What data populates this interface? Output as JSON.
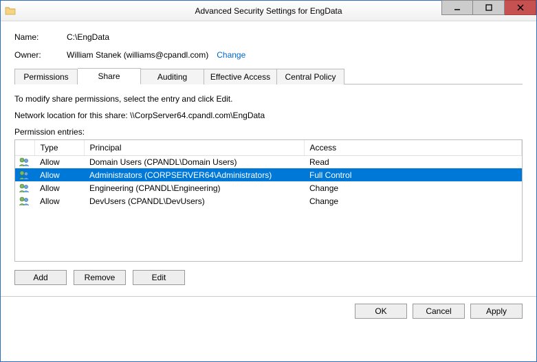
{
  "window": {
    "title": "Advanced Security Settings for EngData"
  },
  "fields": {
    "name_label": "Name:",
    "name_value": "C:\\EngData",
    "owner_label": "Owner:",
    "owner_value": "William Stanek (williams@cpandl.com)",
    "change_link": "Change"
  },
  "tabs": [
    {
      "label": "Permissions",
      "active": false
    },
    {
      "label": "Share",
      "active": true
    },
    {
      "label": "Auditing",
      "active": false
    },
    {
      "label": "Effective Access",
      "active": false
    },
    {
      "label": "Central Policy",
      "active": false
    }
  ],
  "panel": {
    "instruction": "To modify share permissions, select the entry and click Edit.",
    "location_label": "Network location for this share:  \\\\CorpServer64.cpandl.com\\EngData",
    "entries_label": "Permission entries:"
  },
  "columns": {
    "type": "Type",
    "principal": "Principal",
    "access": "Access"
  },
  "entries": [
    {
      "type": "Allow",
      "principal": "Domain Users (CPANDL\\Domain Users)",
      "access": "Read",
      "selected": false
    },
    {
      "type": "Allow",
      "principal": "Administrators (CORPSERVER64\\Administrators)",
      "access": "Full Control",
      "selected": true
    },
    {
      "type": "Allow",
      "principal": "Engineering (CPANDL\\Engineering)",
      "access": "Change",
      "selected": false
    },
    {
      "type": "Allow",
      "principal": "DevUsers (CPANDL\\DevUsers)",
      "access": "Change",
      "selected": false
    }
  ],
  "buttons": {
    "add": "Add",
    "remove": "Remove",
    "edit": "Edit",
    "ok": "OK",
    "cancel": "Cancel",
    "apply": "Apply"
  }
}
